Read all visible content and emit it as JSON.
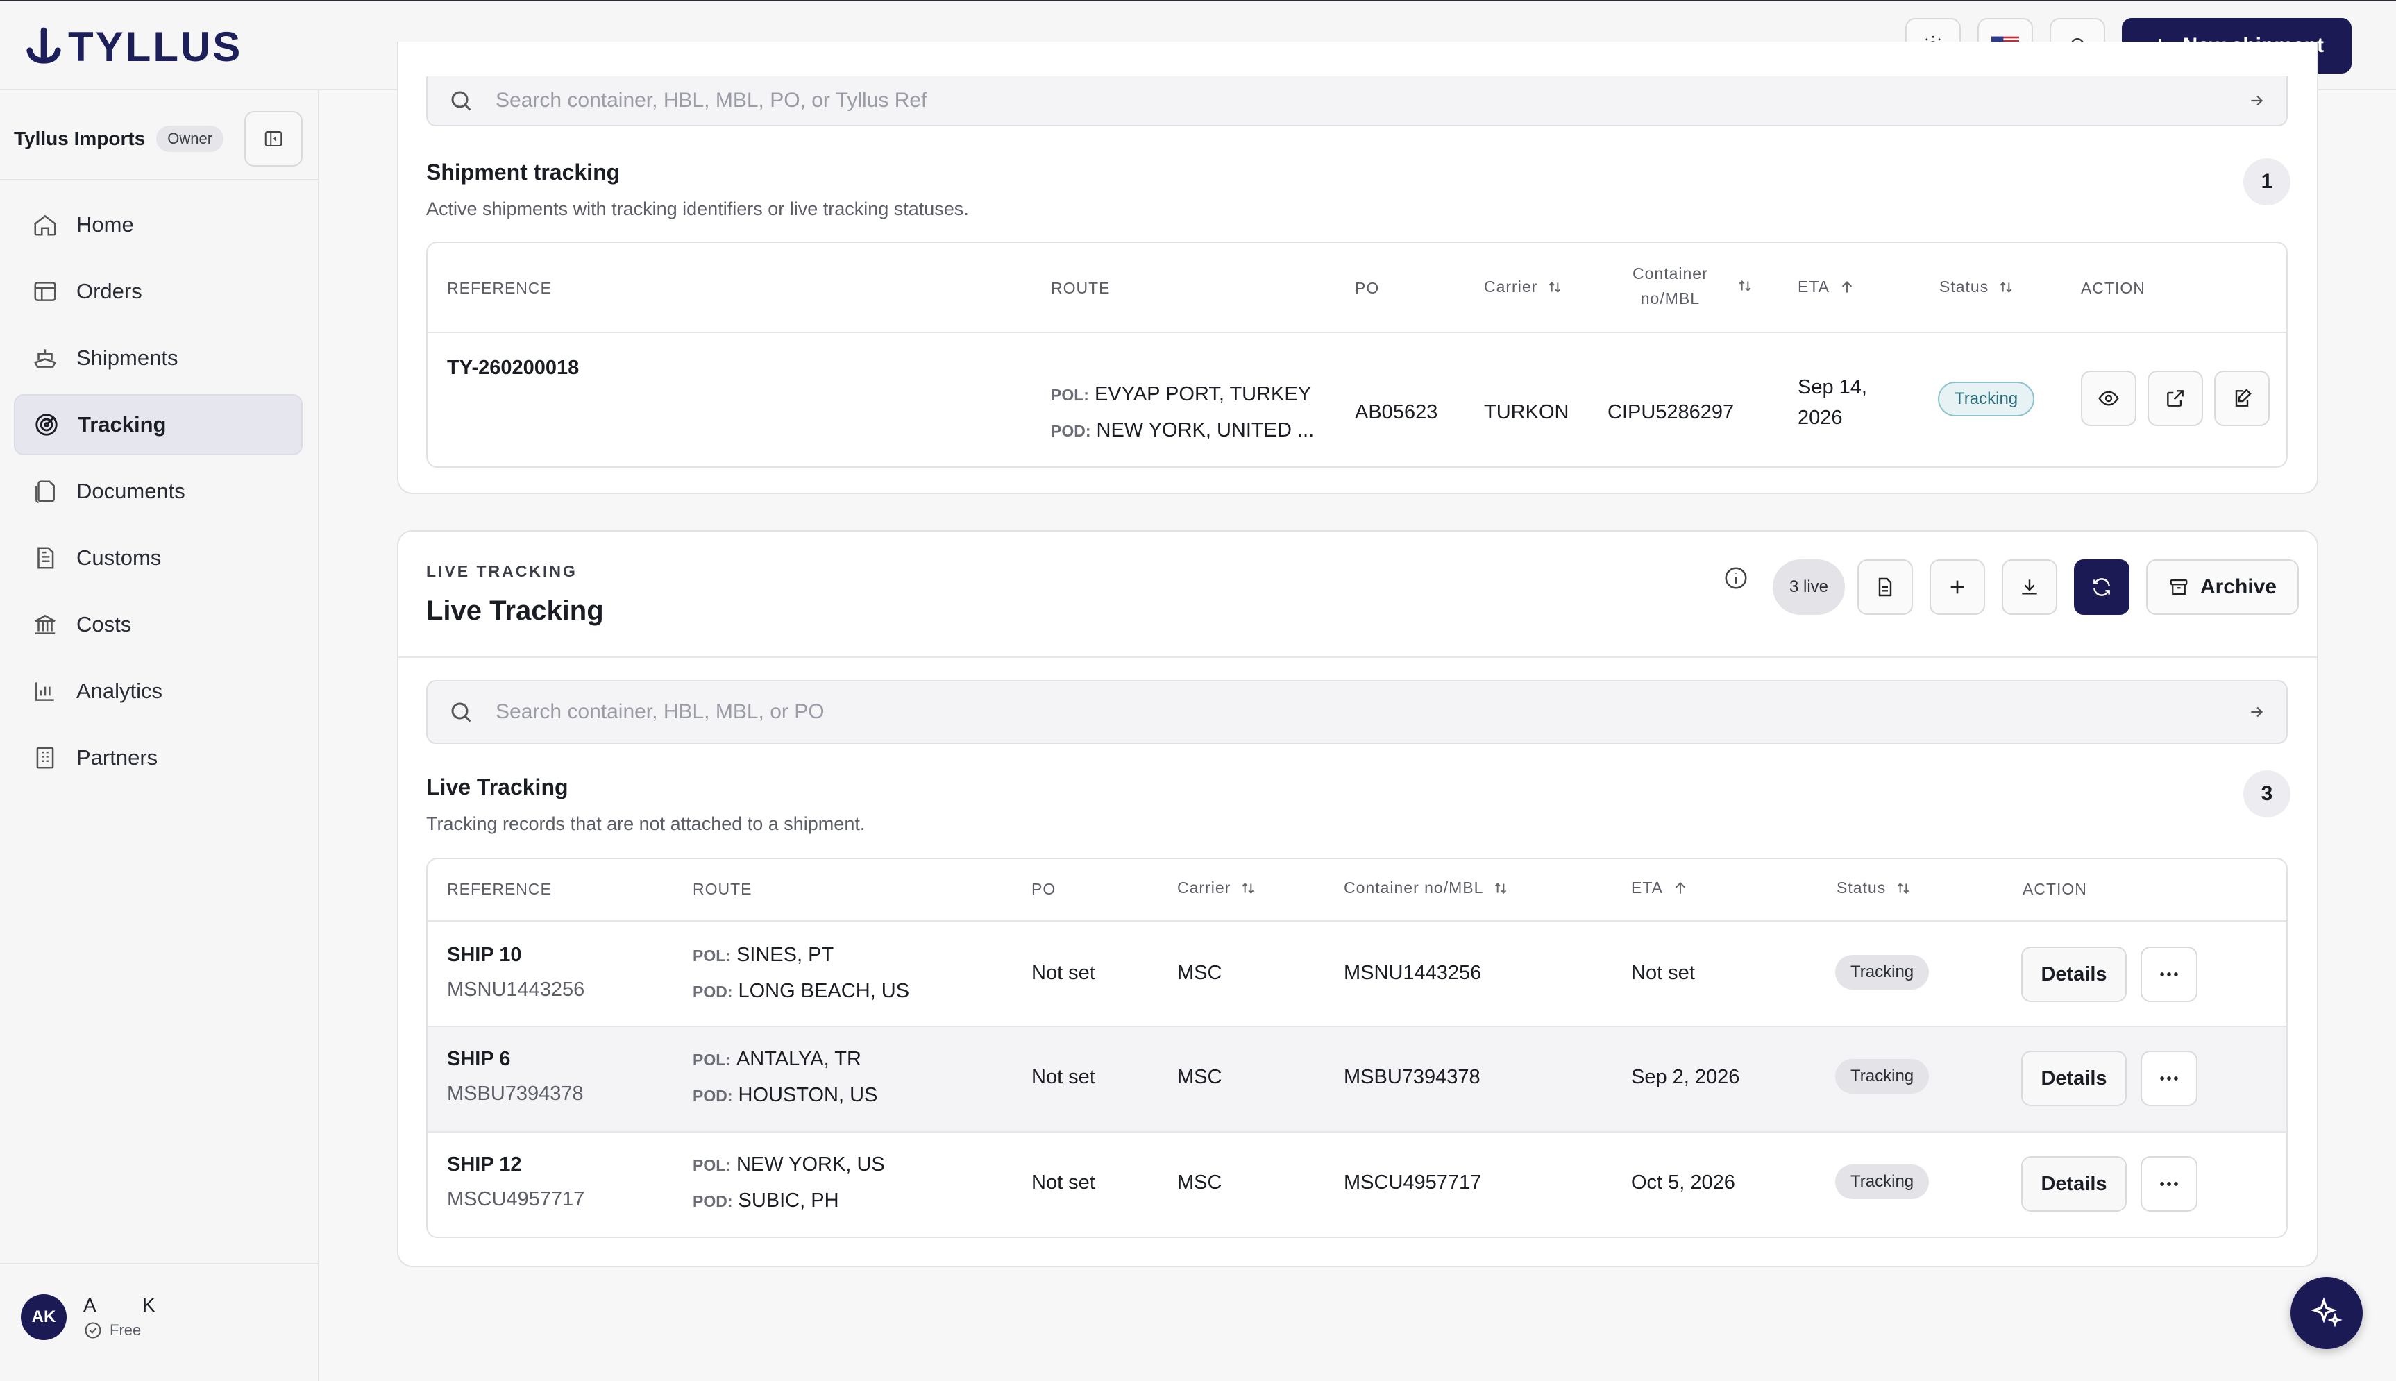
{
  "app": {
    "logo_text": "TYLLUS",
    "new_shipment_label": "New shipment"
  },
  "org": {
    "name": "Tyllus Imports",
    "role": "Owner"
  },
  "nav": {
    "items": [
      {
        "label": "Home",
        "icon": "home-icon"
      },
      {
        "label": "Orders",
        "icon": "orders-icon"
      },
      {
        "label": "Shipments",
        "icon": "ship-icon"
      },
      {
        "label": "Tracking",
        "icon": "target-icon",
        "active": true
      },
      {
        "label": "Documents",
        "icon": "documents-icon"
      },
      {
        "label": "Customs",
        "icon": "customs-icon"
      },
      {
        "label": "Costs",
        "icon": "bank-icon"
      },
      {
        "label": "Analytics",
        "icon": "chart-icon"
      },
      {
        "label": "Partners",
        "icon": "building-icon"
      }
    ]
  },
  "user": {
    "initials": "AK",
    "name": "A K",
    "plan": "Free"
  },
  "shipment_tracking": {
    "search_placeholder": "Search container, HBL, MBL, PO, or Tyllus Ref",
    "title": "Shipment tracking",
    "subtitle": "Active shipments with tracking identifiers or live tracking statuses.",
    "count": "1",
    "headers": {
      "reference": "REFERENCE",
      "route": "ROUTE",
      "po": "PO",
      "carrier": "Carrier",
      "container_line1": "Container",
      "container_line2": "no/MBL",
      "eta": "ETA",
      "status": "Status",
      "action": "ACTION"
    },
    "rows": [
      {
        "reference": "TY-260200018",
        "pol_label": "POL:",
        "pol": "EVYAP PORT, TURKEY",
        "pod_label": "POD:",
        "pod": "NEW YORK, UNITED ...",
        "po": "AB05623",
        "carrier": "TURKON",
        "container": "CIPU5286297",
        "eta_line1": "Sep 14,",
        "eta_line2": "2026",
        "status": "Tracking"
      }
    ]
  },
  "live_tracking": {
    "eyebrow": "LIVE TRACKING",
    "title": "Live Tracking",
    "live_count": "3 live",
    "archive_label": "Archive",
    "search_placeholder": "Search container, HBL, MBL, or PO",
    "list_title": "Live Tracking",
    "list_subtitle": "Tracking records that are not attached to a shipment.",
    "count": "3",
    "headers": {
      "reference": "REFERENCE",
      "route": "ROUTE",
      "po": "PO",
      "carrier": "Carrier",
      "container": "Container no/MBL",
      "eta": "ETA",
      "status": "Status",
      "action": "ACTION"
    },
    "details_label": "Details",
    "rows": [
      {
        "name": "SHIP 10",
        "container_sub": "MSNU1443256",
        "pol_label": "POL:",
        "pol": "SINES, PT",
        "pod_label": "POD:",
        "pod": "LONG BEACH, US",
        "po": "Not set",
        "carrier": "MSC",
        "container": "MSNU1443256",
        "eta": "Not set",
        "status": "Tracking"
      },
      {
        "name": "SHIP 6",
        "container_sub": "MSBU7394378",
        "pol_label": "POL:",
        "pol": "ANTALYA, TR",
        "pod_label": "POD:",
        "pod": "HOUSTON, US",
        "po": "Not set",
        "carrier": "MSC",
        "container": "MSBU7394378",
        "eta": "Sep 2, 2026",
        "status": "Tracking"
      },
      {
        "name": "SHIP 12",
        "container_sub": "MSCU4957717",
        "pol_label": "POL:",
        "pol": "NEW YORK, US",
        "pod_label": "POD:",
        "pod": "SUBIC, PH",
        "po": "Not set",
        "carrier": "MSC",
        "container": "MSCU4957717",
        "eta": "Oct 5, 2026",
        "status": "Tracking"
      }
    ]
  },
  "colors": {
    "brand": "#1c1a55",
    "tracking_teal": "#2a6d7a"
  }
}
